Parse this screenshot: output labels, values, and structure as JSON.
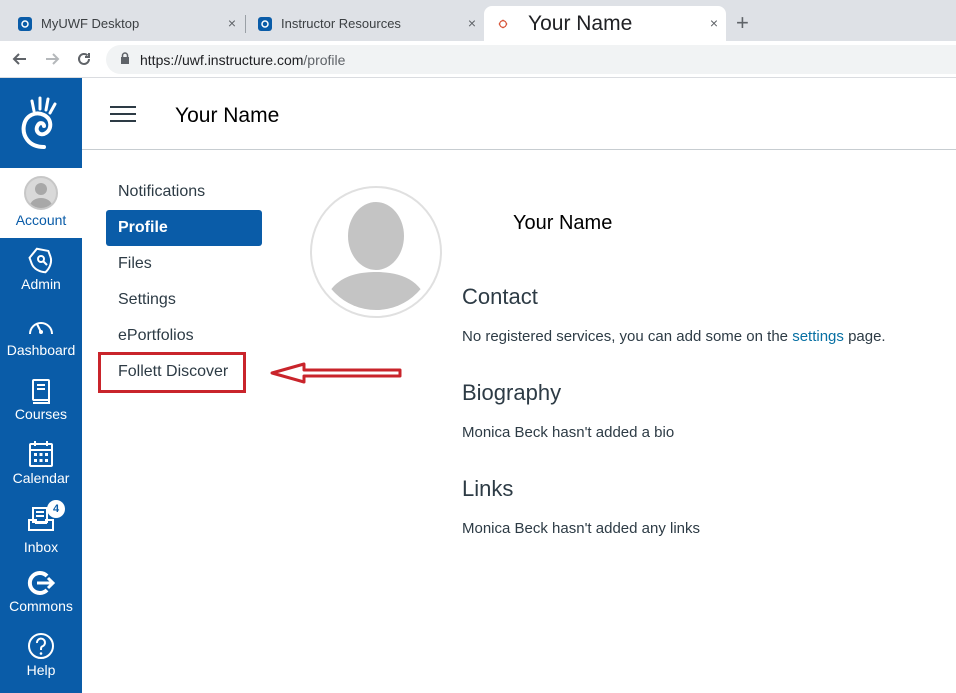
{
  "browser": {
    "tabs": [
      {
        "title": "MyUWF Desktop",
        "close": "×"
      },
      {
        "title": "Instructor Resources",
        "close": "×"
      },
      {
        "title": "Your Name",
        "close": "×"
      }
    ],
    "new_tab": "+",
    "url_host": "https://uwf.instructure.com",
    "url_path": "/profile"
  },
  "global_nav": {
    "items": [
      {
        "label": "Account"
      },
      {
        "label": "Admin"
      },
      {
        "label": "Dashboard"
      },
      {
        "label": "Courses"
      },
      {
        "label": "Calendar"
      },
      {
        "label": "Inbox",
        "badge": "4"
      },
      {
        "label": "Commons"
      },
      {
        "label": "Help"
      }
    ]
  },
  "header": {
    "title": "Your Name"
  },
  "profile_nav": {
    "items": [
      {
        "label": "Notifications"
      },
      {
        "label": "Profile"
      },
      {
        "label": "Files"
      },
      {
        "label": "Settings"
      },
      {
        "label": "ePortfolios"
      },
      {
        "label": "Follett Discover"
      }
    ]
  },
  "profile": {
    "name": "Your Name",
    "contact_heading": "Contact",
    "contact_text_before": "No registered services, you can add some on the",
    "contact_link": "settings",
    "contact_text_after": "page.",
    "bio_heading": "Biography",
    "bio_text": "Monica Beck hasn't added a bio",
    "links_heading": "Links",
    "links_text": "Monica Beck hasn't added any links"
  },
  "colors": {
    "canvas_blue": "#0a5ca8",
    "highlight_red": "#c9242b"
  }
}
